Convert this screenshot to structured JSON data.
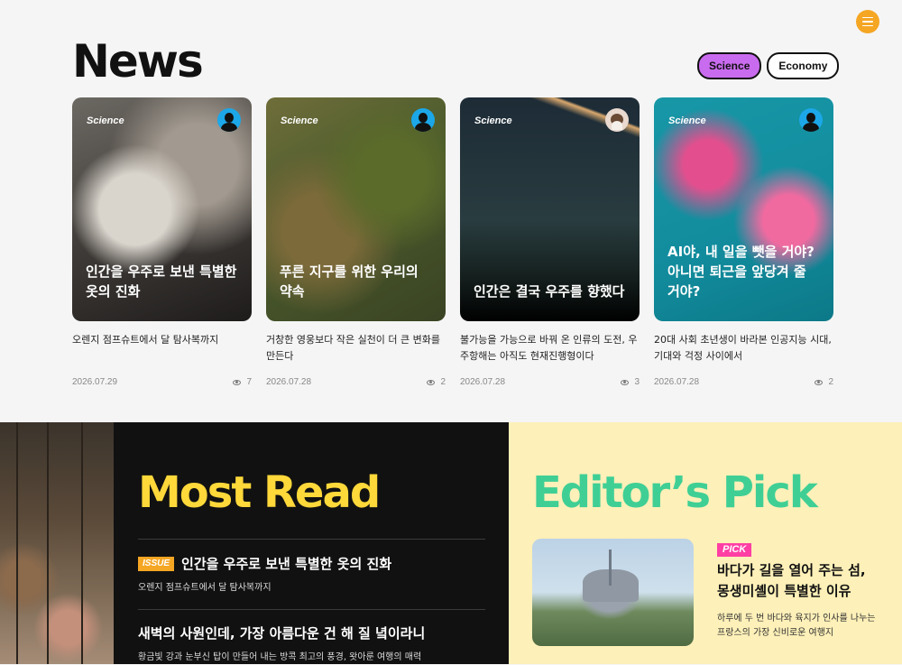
{
  "header": {
    "menu_icon": "hamburger-menu-icon",
    "accent": "#f5a623"
  },
  "news": {
    "title": "News",
    "filters": [
      {
        "label": "Science",
        "active": true
      },
      {
        "label": "Economy",
        "active": false
      }
    ],
    "cards": [
      {
        "tag": "Science",
        "headline": "인간을 우주로 보낸 특별한 옷의 진화",
        "desc": "오렌지 점프슈트에서 달 탐사복까지",
        "date": "2026.07.29",
        "views": "7"
      },
      {
        "tag": "Science",
        "headline": "푸른 지구를 위한 우리의 약속",
        "desc": "거창한 영웅보다 작은 실천이 더 큰 변화를 만든다",
        "date": "2026.07.28",
        "views": "2"
      },
      {
        "tag": "Science",
        "headline": "인간은 결국 우주를 향했다",
        "desc": "불가능을 가능으로 바꿔 온 인류의 도전, 우주항해는 아직도 현재진행형이다",
        "date": "2026.07.28",
        "views": "3"
      },
      {
        "tag": "Science",
        "headline": "AI야, 내 일을 뺏을 거야? 아니면 퇴근을 앞당겨 줄 거야?",
        "desc": "20대 사회 초년생이 바라본 인공지능 시대, 기대와 걱정 사이에서",
        "date": "2026.07.28",
        "views": "2"
      }
    ]
  },
  "most_read": {
    "title": "Most Read",
    "title_color": "#ffd83a",
    "items": [
      {
        "badge": "ISSUE",
        "title": "인간을 우주로 보낸 특별한 옷의 진화",
        "sub": "오렌지 점프슈트에서 달 탐사복까지"
      },
      {
        "title": "새벽의 사원인데, 가장 아름다운 건 해 질 녘이라니",
        "sub": "황금빛 강과 눈부신 탑이 만들어 내는 방콕 최고의 풍경, 왓아룬 여행의 매력"
      }
    ]
  },
  "editors_pick": {
    "title": "Editor’s Pick",
    "title_color": "#3fcf95",
    "tag": "PICK",
    "headline": "바다가 길을 열어 주는 섬, 몽생미셸이 특별한 이유",
    "desc": "하루에 두 번 바다와 육지가 인사를 나누는 프랑스의 가장 신비로운 여행지"
  }
}
